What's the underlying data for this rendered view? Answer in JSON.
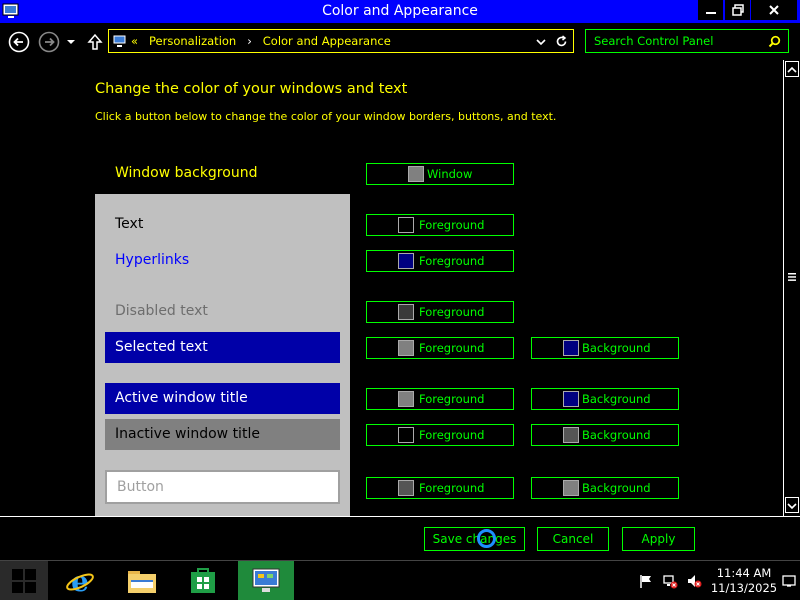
{
  "window": {
    "title": "Color and Appearance"
  },
  "nav": {
    "breadcrumb_prefix": "«",
    "breadcrumb_1": "Personalization",
    "breadcrumb_sep": "›",
    "breadcrumb_2": "Color and Appearance",
    "search_placeholder": "Search Control Panel"
  },
  "content": {
    "heading": "Change the color of your windows and text",
    "subheading": "Click a button below to change the color of your window borders, buttons, and text.",
    "window_background_label": "Window background",
    "window_button_label": "Window",
    "items": {
      "text": "Text",
      "hyperlinks": "Hyperlinks",
      "disabled": "Disabled text",
      "selected": "Selected text",
      "active_title": "Active window title",
      "inactive_title": "Inactive window title",
      "button": "Button"
    },
    "foreground_label": "Foreground",
    "background_label": "Background"
  },
  "actions": {
    "save": "Save changes",
    "cancel": "Cancel",
    "apply": "Apply"
  },
  "taskbar": {
    "time": "11:44 AM",
    "date": "11/13/2025"
  },
  "colors": {
    "accent_yellow": "#ffff00",
    "accent_green": "#00ff00",
    "title_blue": "#0000ff",
    "selection_blue": "#0000a8"
  }
}
